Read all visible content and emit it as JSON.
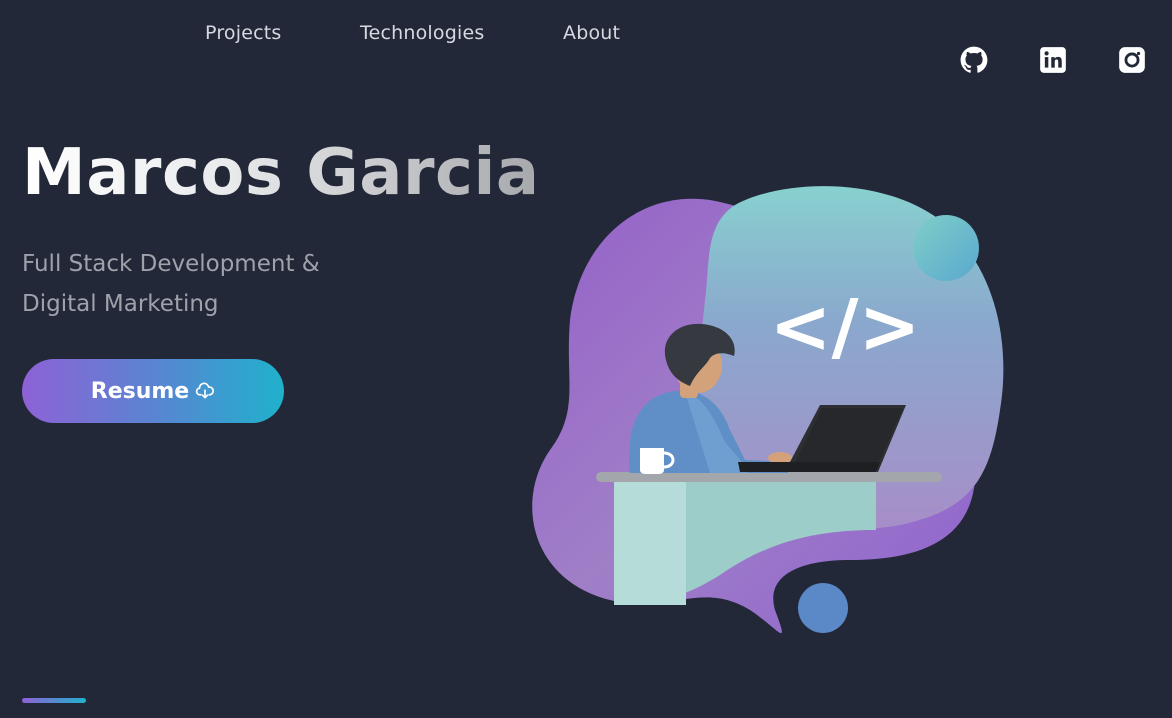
{
  "nav": {
    "items": [
      {
        "label": "Projects"
      },
      {
        "label": "Technologies"
      },
      {
        "label": "About"
      }
    ]
  },
  "social": {
    "items": [
      {
        "name": "github",
        "icon": "github-icon"
      },
      {
        "name": "linkedin",
        "icon": "linkedin-icon"
      },
      {
        "name": "instagram",
        "icon": "instagram-icon"
      }
    ]
  },
  "hero": {
    "title": "Marcos Garcia",
    "subtitle": "Full Stack Development & Digital Marketing",
    "resume_label": "Resume",
    "resume_icon": "cloud-download-icon",
    "illustration_icon": "developer-at-laptop-illustration",
    "code_symbol": "</>"
  },
  "colors": {
    "background": "#222838",
    "accent_purple": "#8e62d6",
    "accent_cyan": "#1fb1cc",
    "text_muted": "#9ea2ab"
  }
}
